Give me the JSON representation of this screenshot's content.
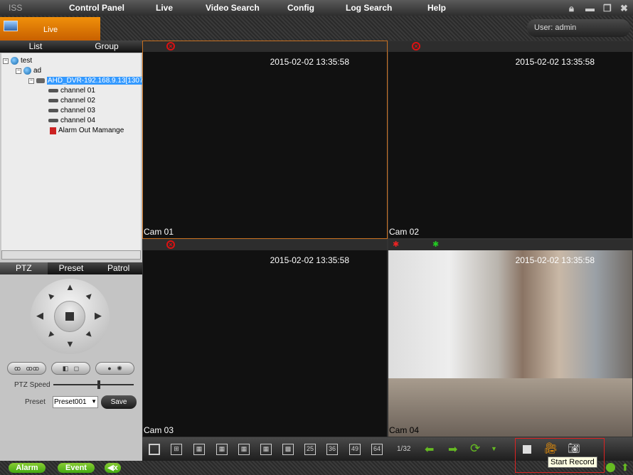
{
  "app": {
    "logo": "ISS"
  },
  "menu": [
    {
      "label": "Control Panel"
    },
    {
      "label": "Live"
    },
    {
      "label": "Video Search"
    },
    {
      "label": "Config"
    },
    {
      "label": "Log Search"
    },
    {
      "label": "Help"
    }
  ],
  "window_controls": [
    "lock-icon",
    "minimize-icon",
    "restore-icon",
    "close-icon"
  ],
  "subbar": {
    "tab_label": "Live",
    "user": "User: admin"
  },
  "device_panel": {
    "tabs": [
      "List",
      "Group"
    ],
    "tree": [
      {
        "label": "test",
        "level": 0
      },
      {
        "label": "ad",
        "level": 1
      },
      {
        "label": "AHD_DVR-192.168.9.13[1307",
        "level": 2,
        "selected": true
      },
      {
        "label": "channel 01",
        "level": 3
      },
      {
        "label": "channel 02",
        "level": 3
      },
      {
        "label": "channel 03",
        "level": 3
      },
      {
        "label": "channel 04",
        "level": 3
      },
      {
        "label": "Alarm Out Mamange",
        "level": 3
      }
    ]
  },
  "ptz": {
    "tabs": [
      "PTZ",
      "Preset",
      "Patrol"
    ],
    "speed_label": "PTZ Speed",
    "speed_value": 0.55,
    "preset_label": "Preset",
    "preset_value": "Preset001",
    "save_label": "Save"
  },
  "cameras": [
    {
      "name": "Cam 01",
      "timestamp": "2015-02-02 13:35:58"
    },
    {
      "name": "Cam 02",
      "timestamp": "2015-02-02 13:35:58"
    },
    {
      "name": "Cam 03",
      "timestamp": "2015-02-02 13:35:58"
    },
    {
      "name": "Cam 04",
      "timestamp": "2015-02-02 13:35:58"
    }
  ],
  "toolbar": {
    "layouts": [
      "1",
      "4",
      "6",
      "8",
      "9",
      "10",
      "16",
      "25",
      "36",
      "49",
      "64"
    ],
    "page": "1/32",
    "tooltip": "Start Record"
  },
  "status": {
    "alarm": "Alarm",
    "event": "Event"
  },
  "colors": {
    "accent": "#e57c00",
    "selected": "#3399ff",
    "green": "#6bb82a"
  }
}
